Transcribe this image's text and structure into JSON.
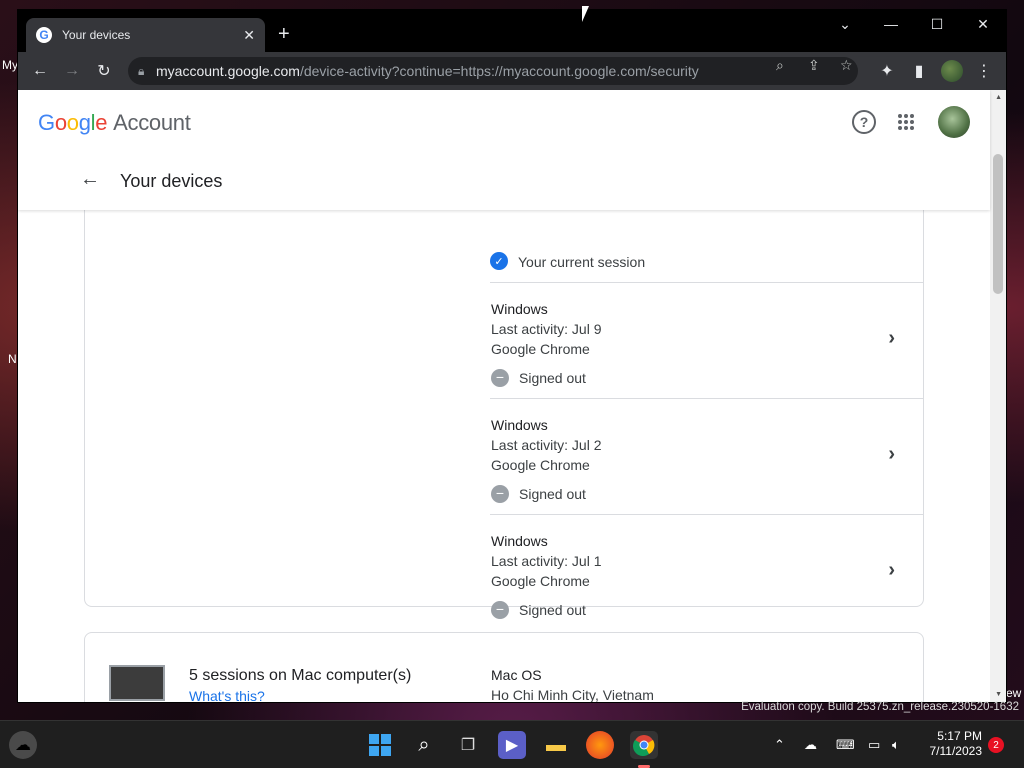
{
  "desktop": {
    "label_my": "My",
    "label_n": "N",
    "label_ew": "ew"
  },
  "browser": {
    "tab": {
      "title": "Your devices",
      "favicon": "G",
      "close_glyph": "✕"
    },
    "newtab_glyph": "+",
    "window_controls": {
      "dropdown": "⌄",
      "minimize": "—",
      "maximize": "☐",
      "close": "✕"
    },
    "nav": {
      "back": "←",
      "forward": "→",
      "reload": "↻"
    },
    "omnibox": {
      "host": "myaccount.google.com",
      "path": "/device-activity?continue=https://myaccount.google.com/security"
    },
    "toolbar_icons": [
      "search-icon",
      "share-icon",
      "star-icon",
      "extensions-icon",
      "sidepanel-icon",
      "profile-avatar",
      "menu-icon"
    ]
  },
  "header": {
    "logo_letters": [
      "G",
      "o",
      "o",
      "g",
      "l",
      "e"
    ],
    "logo_suffix": "Account",
    "help_glyph": "?",
    "apps_glyph": "⋮⋮⋮",
    "back_glyph": "←",
    "title": "Your devices"
  },
  "current_session": {
    "check_glyph": "✓",
    "label": "Your current session"
  },
  "sessions": [
    {
      "os": "Windows",
      "activity": "Last activity: Jul 9",
      "browser": "Google Chrome",
      "status": "Signed out"
    },
    {
      "os": "Windows",
      "activity": "Last activity: Jul 2",
      "browser": "Google Chrome",
      "status": "Signed out"
    },
    {
      "os": "Windows",
      "activity": "Last activity: Jul 1",
      "browser": "Google Chrome",
      "status": "Signed out"
    }
  ],
  "chevron_glyph": "›",
  "mac_card": {
    "title": "5 sessions on Mac computer(s)",
    "link": "What's this?",
    "os": "Mac OS",
    "location": "Ho Chi Minh City, Vietnam",
    "icon_glyph": ""
  },
  "watermark": "Evaluation copy. Build 25375.zn_release.230520-1632",
  "taskbar": {
    "time": "5:17 PM",
    "date": "7/11/2023",
    "notification_count": "2",
    "apps": [
      "widgets-icon",
      "start-icon",
      "search-icon",
      "task-view-icon",
      "meet-icon",
      "file-explorer-icon",
      "firefox-icon",
      "chrome-icon"
    ]
  },
  "colors": {
    "accent": "#1a73e8",
    "google_blue": "#4285f4",
    "google_red": "#ea4335",
    "google_yellow": "#fbbc05",
    "google_green": "#34a853"
  }
}
